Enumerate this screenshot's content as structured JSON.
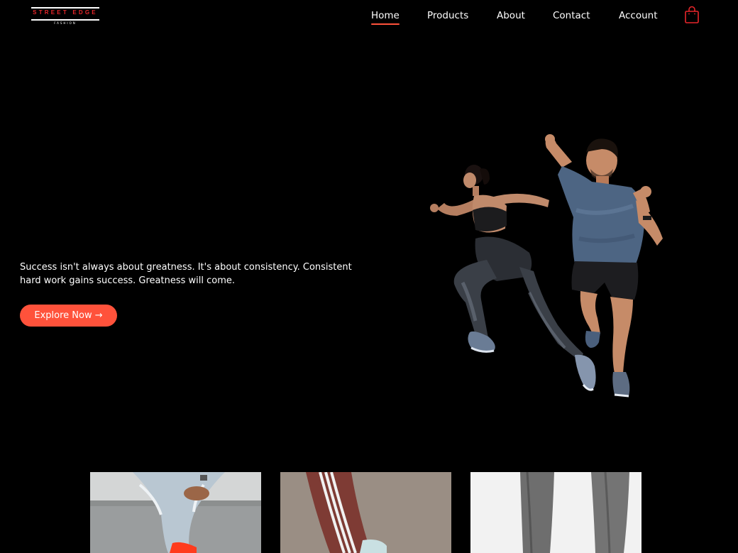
{
  "brand": {
    "name": "STREET EDGE",
    "tagline": "FASHION"
  },
  "nav": {
    "items": [
      {
        "label": "Home",
        "active": true
      },
      {
        "label": "Products",
        "active": false
      },
      {
        "label": "About",
        "active": false
      },
      {
        "label": "Contact",
        "active": false
      },
      {
        "label": "Account",
        "active": false
      }
    ],
    "cart_icon": "shopping-bag-icon"
  },
  "hero": {
    "text": "Success isn't always about greatness. It's about consistency. Consistent hard work gains success. Greatness will come.",
    "button_label": "Explore Now →",
    "image": "two-sprinting-athletes"
  },
  "products": [
    {
      "image": "ripped-jeans-red-sneakers"
    },
    {
      "image": "striped-track-pants"
    },
    {
      "image": "grey-joggers"
    }
  ],
  "colors": {
    "background": "#000000",
    "accent": "#ff523b",
    "logo_red": "#e8262a",
    "text": "#ffffff"
  }
}
